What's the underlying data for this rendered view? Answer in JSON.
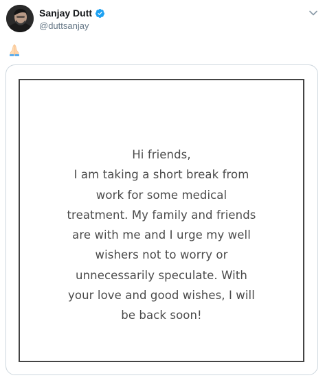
{
  "user": {
    "display_name": "Sanjay Dutt",
    "handle": "@duttsanjay",
    "verified": true,
    "avatar_icon": "avatar-photo"
  },
  "header": {
    "menu_icon": "chevron-down-icon"
  },
  "tweet": {
    "emoji": "🙏",
    "emoji_icon": "folded-hands-icon"
  },
  "note": {
    "lines": [
      "Hi friends,",
      "I am taking a short break from",
      "work for some medical",
      "treatment. My family and friends",
      "are with me and I urge my well",
      "wishers not to worry or",
      "unnecessarily speculate. With",
      "your love and good wishes, I will",
      "be back soon!"
    ]
  },
  "colors": {
    "verified_badge": "#1da1f2",
    "handle_text": "#657786",
    "card_border": "#ccd6dd",
    "note_text": "#4a4a4a",
    "note_frame": "#444444"
  }
}
